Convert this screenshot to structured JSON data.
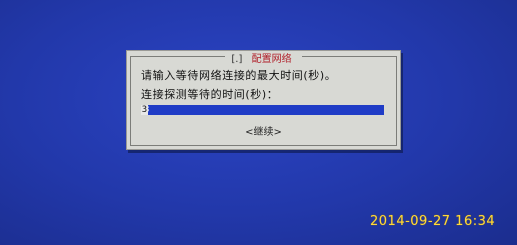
{
  "dialog": {
    "title_left": "[.]",
    "title": "配置网络",
    "prompt": "请输入等待网络连接的最大时间(秒)。",
    "field_label": "连接探测等待的时间(秒)：",
    "input_value": "3",
    "button_label": "<继续>"
  },
  "photo": {
    "timestamp": "2014-09-27 16:34"
  },
  "colors": {
    "screen_background": "#2238aa",
    "dialog_background": "#d8d9d4",
    "title_color": "#b0202a",
    "input_background": "#1f3cc6",
    "timestamp_color": "#ffd93a"
  }
}
